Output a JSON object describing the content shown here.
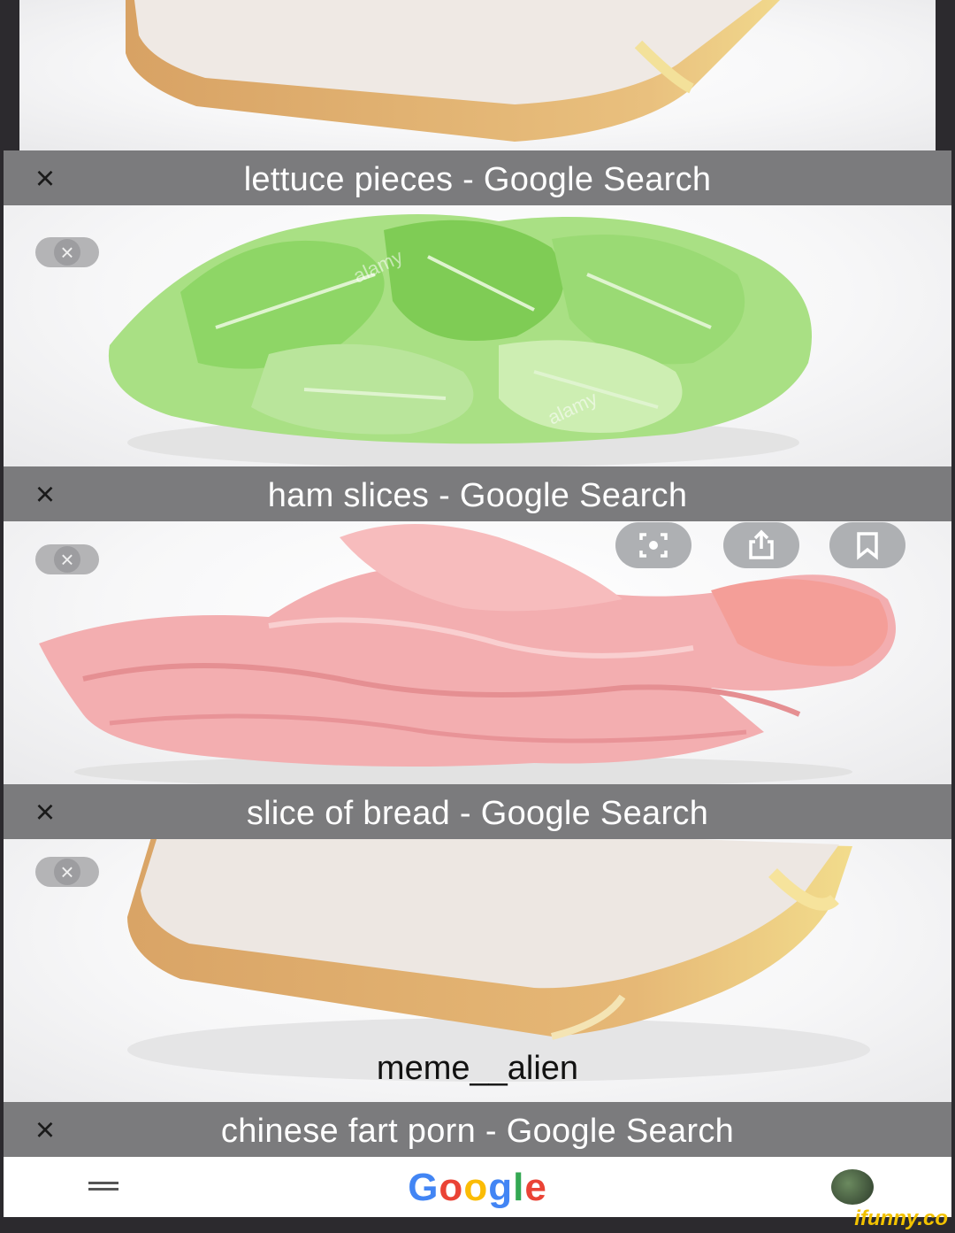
{
  "tabs": [
    {
      "title": "lettuce pieces - Google Search",
      "close": "×"
    },
    {
      "title": "ham slices - Google Search",
      "close": "×"
    },
    {
      "title": "slice of bread - Google Search",
      "close": "×"
    },
    {
      "title": "chinese fart porn - Google Search",
      "close": "×"
    }
  ],
  "image_watermarks": {
    "stock": "alamy"
  },
  "caption": "meme__alien",
  "browser_bar": {
    "menu_icon": "hamburger-icon",
    "logo": "Google",
    "avatar": "avatar"
  },
  "site_watermark": "ifunny.co",
  "icons": {
    "close": "close-icon",
    "lens": "lens-icon",
    "share": "share-icon",
    "bookmark": "bookmark-icon"
  },
  "colors": {
    "tab_bar": "#7b7b7d",
    "background": "#2c2a2e",
    "ham": "#f2a7a8",
    "lettuce": "#8fd46a",
    "bread_crust": "#e0ae73"
  }
}
